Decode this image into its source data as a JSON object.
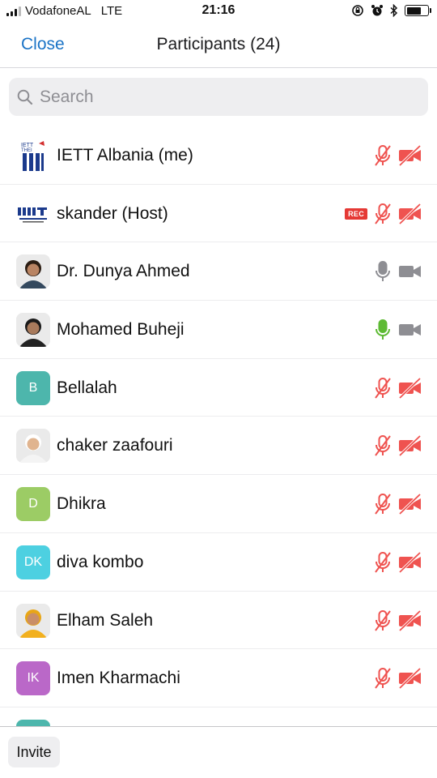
{
  "status_bar": {
    "carrier": "VodafoneAL",
    "network": "LTE",
    "time": "21:16",
    "battery_level": 0.7
  },
  "nav": {
    "close_label": "Close",
    "title": "Participants (24)"
  },
  "search": {
    "placeholder": "Search",
    "value": ""
  },
  "colors": {
    "accent": "#1a73c6",
    "muted_red": "#ef5350",
    "active_green": "#5dba33",
    "neutral_gray": "#8e8e93"
  },
  "participants": [
    {
      "name": "IETT Albania (me)",
      "avatar": "logo-iett",
      "mic": "muted",
      "video": "off"
    },
    {
      "name": "skander (Host)",
      "avatar": "logo-mit",
      "badge": "REC",
      "mic": "muted",
      "video": "off"
    },
    {
      "name": "Dr. Dunya Ahmed",
      "avatar": "photo",
      "mic": "idle",
      "video": "on"
    },
    {
      "name": "Mohamed Buheji",
      "avatar": "photo",
      "mic": "speaking",
      "video": "on"
    },
    {
      "name": "Bellalah",
      "avatar": "letter",
      "initials": "B",
      "avatar_color": "#4db6ac",
      "mic": "muted",
      "video": "off"
    },
    {
      "name": "chaker zaafouri",
      "avatar": "photo",
      "mic": "muted",
      "video": "off"
    },
    {
      "name": "Dhikra",
      "avatar": "letter",
      "initials": "D",
      "avatar_color": "#9ccc65",
      "mic": "muted",
      "video": "off"
    },
    {
      "name": "diva kombo",
      "avatar": "letter",
      "initials": "DK",
      "avatar_color": "#4dd0e1",
      "mic": "muted",
      "video": "off"
    },
    {
      "name": "Elham Saleh",
      "avatar": "photo",
      "mic": "muted",
      "video": "off"
    },
    {
      "name": "Imen Kharmachi",
      "avatar": "letter",
      "initials": "IK",
      "avatar_color": "#ba68c8",
      "mic": "muted",
      "video": "off"
    },
    {
      "name": "",
      "avatar": "letter",
      "initials": "",
      "avatar_color": "#4db6ac",
      "mic": "muted",
      "video": "off"
    }
  ],
  "footer": {
    "invite_label": "Invite"
  }
}
